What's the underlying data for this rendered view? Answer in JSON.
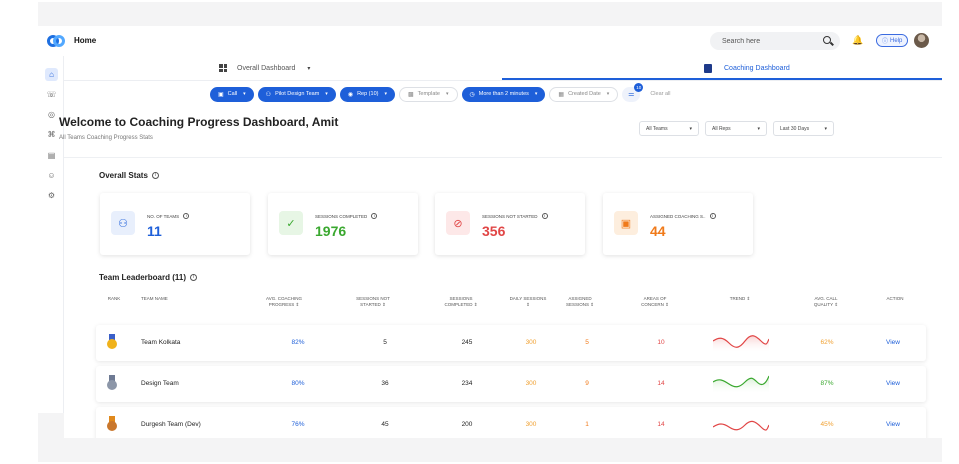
{
  "header": {
    "title": "Home",
    "search_placeholder": "Search here",
    "help_label": "Help"
  },
  "sidebar": {
    "items": [
      {
        "icon": "home-icon",
        "glyph": "⌂"
      },
      {
        "icon": "chat-icon",
        "glyph": "☏"
      },
      {
        "icon": "target-icon",
        "glyph": "◎"
      },
      {
        "icon": "graduation-icon",
        "glyph": "⌘"
      },
      {
        "icon": "library-icon",
        "glyph": "▤"
      },
      {
        "icon": "team-icon",
        "glyph": "☺"
      },
      {
        "icon": "settings-icon",
        "glyph": "⚙"
      }
    ]
  },
  "tabs": {
    "overall": "Overall Dashboard",
    "coaching": "Coaching Dashboard"
  },
  "filters": {
    "call": "Call",
    "team": "Pilot Design Team",
    "rep": "Rep (10)",
    "template": "Template",
    "duration": "More than 2 minutes",
    "created": "Created Date",
    "badge_count": "10",
    "clear_all": "Clear all"
  },
  "welcome": {
    "title": "Welcome to Coaching Progress Dashboard, Amit",
    "subtitle": "All Teams Coaching Progress Stats"
  },
  "selects": {
    "teams": "All Teams",
    "reps": "All Reps",
    "period": "Last 30 Days"
  },
  "overall": {
    "title": "Overall Stats",
    "cards": [
      {
        "label": "No. of Teams",
        "value": "11",
        "color": "#1e5fd9",
        "bg": "#e8effc",
        "icon": "people-icon",
        "glyph": "👥"
      },
      {
        "label": "Sessions Completed",
        "value": "1976",
        "color": "#3aa82f",
        "bg": "#e7f6e5",
        "icon": "check-circle-icon",
        "glyph": "✓"
      },
      {
        "label": "Sessions Not Started",
        "value": "356",
        "color": "#e14646",
        "bg": "#fde8e8",
        "icon": "prohibited-icon",
        "glyph": "⊘"
      },
      {
        "label": "Assigned Coaching S..",
        "value": "44",
        "color": "#f07a1a",
        "bg": "#fdeede",
        "icon": "clipboard-icon",
        "glyph": "▣"
      }
    ]
  },
  "leaderboard": {
    "title": "Team Leaderboard (11)",
    "columns": {
      "rank": "Rank",
      "team": "Team Name",
      "progress": "Avg. Coaching Progress",
      "not_started": "Sessions Not Started",
      "completed": "Sessions Completed",
      "daily": "Daily Sessions",
      "assigned": "Assigned Sessions",
      "concern": "Areas of Concern",
      "trend": "Trend",
      "quality": "Avg. Call Quality",
      "action": "Action"
    },
    "rows": [
      {
        "medal": "gold",
        "team": "Team Kolkata",
        "progress": "82%",
        "not_started": "5",
        "completed": "245",
        "daily": "300",
        "assigned": "5",
        "concern": "10",
        "trend": "down",
        "quality": "62%",
        "quality_color": "#f0a030",
        "action": "View"
      },
      {
        "medal": "silver",
        "team": "Design Team",
        "progress": "80%",
        "not_started": "36",
        "completed": "234",
        "daily": "300",
        "assigned": "9",
        "concern": "14",
        "trend": "up",
        "quality": "87%",
        "quality_color": "#3aa82f",
        "action": "View"
      },
      {
        "medal": "bronze",
        "team": "Durgesh Team (Dev)",
        "progress": "76%",
        "not_started": "45",
        "completed": "200",
        "daily": "300",
        "assigned": "1",
        "concern": "14",
        "trend": "down",
        "quality": "45%",
        "quality_color": "#f0a030",
        "action": "View"
      }
    ]
  }
}
